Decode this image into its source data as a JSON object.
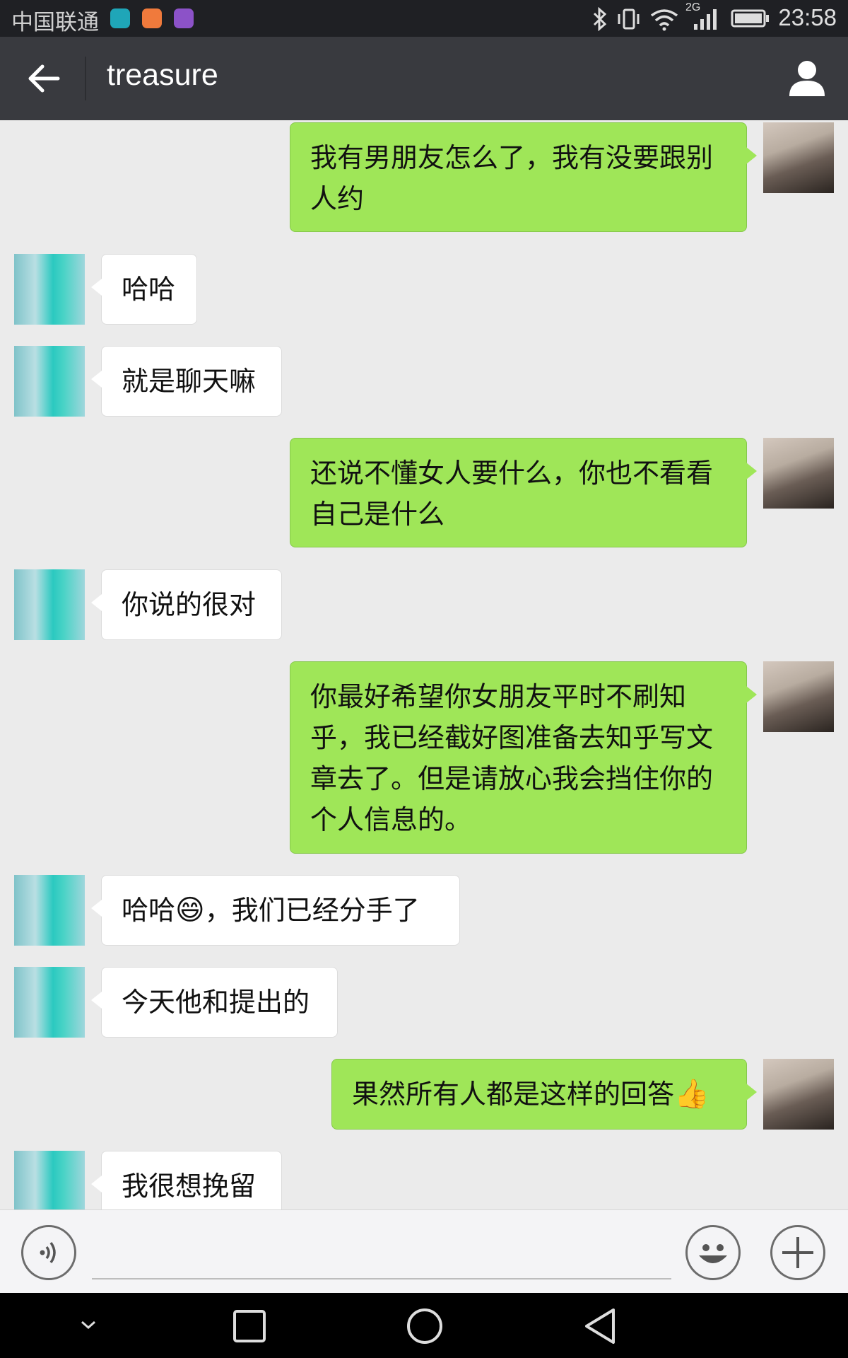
{
  "status": {
    "carrier": "中国联通",
    "time": "23:58",
    "network": "2G"
  },
  "header": {
    "contact_name": "treasure"
  },
  "messages": [
    {
      "from": "me",
      "text": "我有男朋友怎么了，我有没要跟别人约"
    },
    {
      "from": "them",
      "text": "哈哈"
    },
    {
      "from": "them",
      "text": "就是聊天嘛"
    },
    {
      "from": "me",
      "text": "还说不懂女人要什么，你也不看看自己是什么"
    },
    {
      "from": "them",
      "text": "你说的很对"
    },
    {
      "from": "me",
      "text": "你最好希望你女朋友平时不刷知乎，我已经截好图准备去知乎写文章去了。但是请放心我会挡住你的个人信息的。"
    },
    {
      "from": "them",
      "text_before": "哈哈",
      "emoji": "😄",
      "text_after": "，我们已经分手了"
    },
    {
      "from": "them",
      "text": "今天他和提出的"
    },
    {
      "from": "me",
      "text": "果然所有人都是这样的回答",
      "emoji": "👍"
    },
    {
      "from": "them",
      "text": "我很想挽留"
    }
  ],
  "input": {
    "value": ""
  },
  "icons": {
    "back": "arrow-left-icon",
    "profile": "person-icon",
    "voice": "voice-icon",
    "emoji": "emoji-icon",
    "more": "plus-icon"
  },
  "colors": {
    "outgoing_bubble": "#9fe658",
    "incoming_bubble": "#ffffff",
    "title_bar": "#393a3f",
    "chat_bg": "#ebebeb"
  }
}
